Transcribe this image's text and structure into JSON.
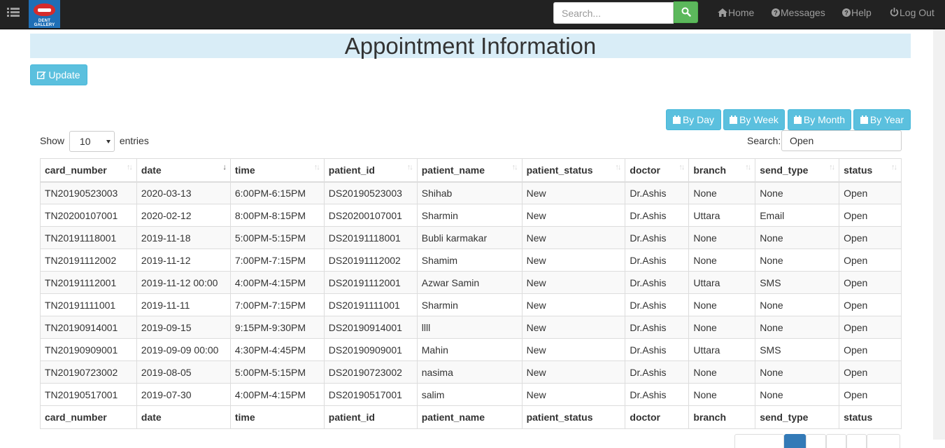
{
  "navbar": {
    "search_placeholder": "Search...",
    "links": [
      {
        "label": "Home",
        "icon": "home-icon"
      },
      {
        "label": "Messages",
        "icon": "question-circle-icon"
      },
      {
        "label": "Help",
        "icon": "question-circle-icon"
      },
      {
        "label": "Log Out",
        "icon": "power-icon"
      }
    ],
    "search_button_color": "#5cb85c",
    "logo_text": "DENT GALLERY"
  },
  "page": {
    "title": "Appointment Information",
    "update_label": "Update"
  },
  "filters": [
    {
      "label": "By Day"
    },
    {
      "label": "By Week"
    },
    {
      "label": "By Month"
    },
    {
      "label": "By Year"
    }
  ],
  "table_controls": {
    "show_label": "Show",
    "page_length": "10",
    "entries_label": "entries",
    "search_label": "Search:",
    "search_value": "Open"
  },
  "table": {
    "columns": [
      "card_number",
      "date",
      "time",
      "patient_id",
      "patient_name",
      "patient_status",
      "doctor",
      "branch",
      "send_type",
      "status"
    ],
    "rows": [
      [
        "TN20190523003",
        "2020-03-13",
        "6:00PM-6:15PM",
        "DS20190523003",
        "Shihab",
        "New",
        "Dr.Ashis",
        "None",
        "None",
        "Open"
      ],
      [
        "TN20200107001",
        "2020-02-12",
        "8:00PM-8:15PM",
        "DS20200107001",
        "Sharmin",
        "New",
        "Dr.Ashis",
        "Uttara",
        "Email",
        "Open"
      ],
      [
        "TN20191118001",
        "2019-11-18",
        "5:00PM-5:15PM",
        "DS20191118001",
        "Bubli karmakar",
        "New",
        "Dr.Ashis",
        "None",
        "None",
        "Open"
      ],
      [
        "TN20191112002",
        "2019-11-12",
        "7:00PM-7:15PM",
        "DS20191112002",
        "Shamim",
        "New",
        "Dr.Ashis",
        "None",
        "None",
        "Open"
      ],
      [
        "TN20191112001",
        "2019-11-12 00:00",
        "4:00PM-4:15PM",
        "DS20191112001",
        "Azwar Samin",
        "New",
        "Dr.Ashis",
        "Uttara",
        "SMS",
        "Open"
      ],
      [
        "TN20191111001",
        "2019-11-11",
        "7:00PM-7:15PM",
        "DS20191111001",
        "Sharmin",
        "New",
        "Dr.Ashis",
        "None",
        "None",
        "Open"
      ],
      [
        "TN20190914001",
        "2019-09-15",
        "9:15PM-9:30PM",
        "DS20190914001",
        "llll",
        "New",
        "Dr.Ashis",
        "None",
        "None",
        "Open"
      ],
      [
        "TN20190909001",
        "2019-09-09 00:00",
        "4:30PM-4:45PM",
        "DS20190909001",
        "Mahin",
        "New",
        "Dr.Ashis",
        "Uttara",
        "SMS",
        "Open"
      ],
      [
        "TN20190723002",
        "2019-08-05",
        "5:00PM-5:15PM",
        "DS20190723002",
        "nasima",
        "New",
        "Dr.Ashis",
        "None",
        "None",
        "Open"
      ],
      [
        "TN20190517001",
        "2019-07-30",
        "4:00PM-4:15PM",
        "DS20190517001",
        "salim",
        "New",
        "Dr.Ashis",
        "None",
        "None",
        "Open"
      ]
    ],
    "sorted_column": "date",
    "sort_direction": "descending"
  },
  "colors": {
    "navbar": "#222222",
    "header_band": "#d9edf7",
    "info_button": "#5bc0de",
    "pagination_active": "#337ab7"
  }
}
